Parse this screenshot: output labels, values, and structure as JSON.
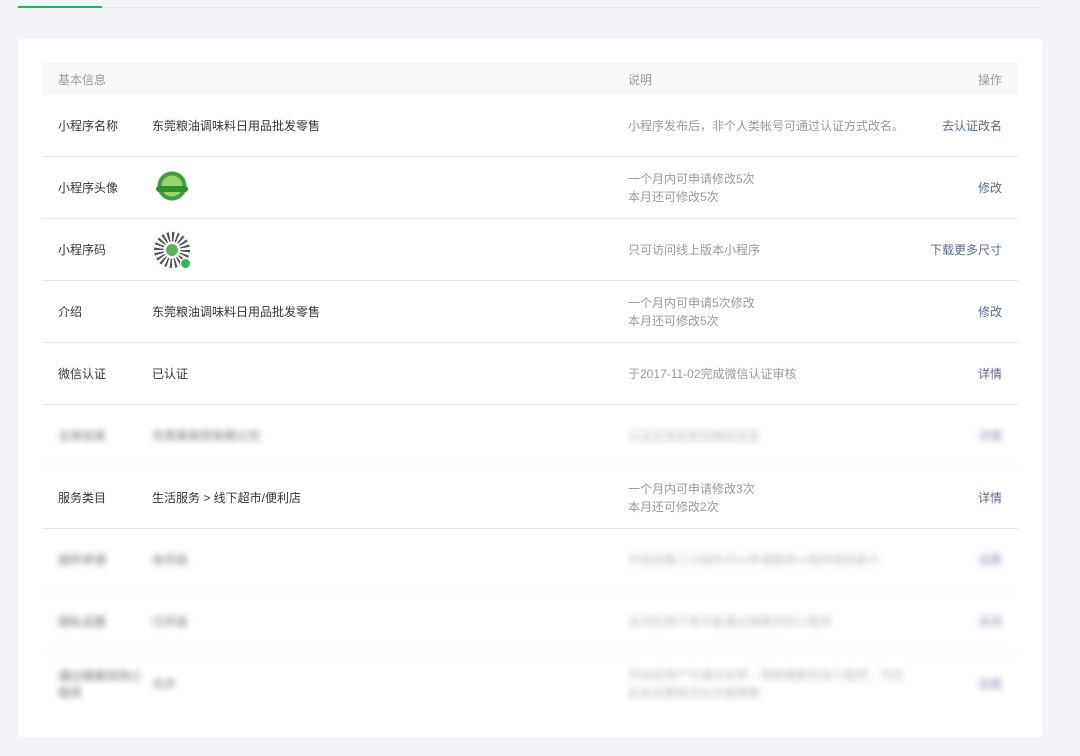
{
  "tabs": {
    "active_color": "#07c160"
  },
  "table": {
    "headers": {
      "label": "基本信息",
      "desc": "说明",
      "op": "操作"
    },
    "rows": [
      {
        "label": "小程序名称",
        "value": "东莞粮油调味料日用品批发零售",
        "desc1": "小程序发布后，非个人类帐号可通过认证方式改名。",
        "desc2": "",
        "op": "去认证改名"
      },
      {
        "label": "小程序头像",
        "value": "",
        "desc1": "一个月内可申请修改5次",
        "desc2": "本月还可修改5次",
        "op": "修改"
      },
      {
        "label": "小程序码",
        "value": "",
        "desc1": "只可访问线上版本小程序",
        "desc2": "",
        "op": "下载更多尺寸"
      },
      {
        "label": "介绍",
        "value": "东莞粮油调味料日用品批发零售",
        "desc1": "一个月内可申请5次修改",
        "desc2": "本月还可修改5次",
        "op": "修改"
      },
      {
        "label": "微信认证",
        "value": "已认证",
        "desc1": "于2017-11-02完成微信认证审核",
        "desc2": "",
        "op": "详情"
      },
      {
        "label": "主体信息",
        "value": "东莞某商贸有限公司",
        "desc1": "认证主体名称及相关信息",
        "desc2": "",
        "op": "详情"
      },
      {
        "label": "服务类目",
        "value": "生活服务 > 线下超市/便利店",
        "desc1": "一个月内可申请修改3次",
        "desc2": "本月还可修改2次",
        "op": "详情"
      },
      {
        "label": "插件申请",
        "value": "未开启",
        "desc1": "开启后第三方插件可以申请使用小程序相关能力",
        "desc2": "",
        "op": "设置"
      },
      {
        "label": "隐私设置",
        "value": "已开启",
        "desc1": "关闭后用户将不能通过搜索找到小程序",
        "desc2": "",
        "op": "关闭"
      },
      {
        "label": "通过搜索找到小程序",
        "value": "允许",
        "desc1": "开启后用户可通过名称、简称搜索到该小程序，可在",
        "desc2": "此处设置是否允许被搜索",
        "op": "设置"
      }
    ]
  }
}
